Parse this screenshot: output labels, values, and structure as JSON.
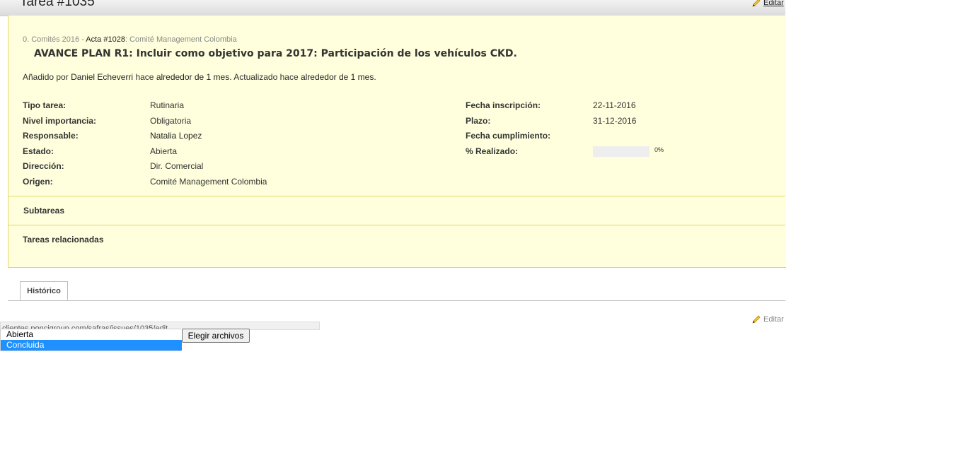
{
  "header": {
    "title": "Tarea #1035",
    "edit_label": "Editar"
  },
  "breadcrumb": {
    "parent": "0. Comités 2016",
    "separator": " - ",
    "acta": "Acta #1028",
    "acta_suffix": ": Comité Management Colombia"
  },
  "issue": {
    "subject": "AVANCE PLAN R1: Incluir como objetivo para 2017: Participación de los vehículos CKD.",
    "author_prefix": "Añadido por ",
    "author": "Daniel Echeverri",
    "author_middle": " hace ",
    "created_ago": "alrededor de 1 mes",
    "updated_prefix": ". Actualizado hace ",
    "updated_ago": "alrededor de 1 mes",
    "updated_suffix": "."
  },
  "attributes_left": [
    {
      "label": "Tipo tarea:",
      "value": "Rutinaria"
    },
    {
      "label": "Nivel importancia:",
      "value": "Obligatoria"
    },
    {
      "label": "Responsable:",
      "value": "Natalia Lopez"
    },
    {
      "label": "Estado:",
      "value": "Abierta"
    },
    {
      "label": "Dirección:",
      "value": "Dir. Comercial"
    },
    {
      "label": "Origen:",
      "value": "Comité Management Colombia"
    }
  ],
  "attributes_right": [
    {
      "label": "Fecha inscripción:",
      "value": "22-11-2016"
    },
    {
      "label": "Plazo:",
      "value": "31-12-2016"
    },
    {
      "label": "Fecha cumplimiento:",
      "value": ""
    },
    {
      "label": "% Realizado:",
      "value": "0%"
    }
  ],
  "progress": {
    "done_fraction": 0,
    "label": "0%"
  },
  "sections": {
    "subtasks": "Subtareas",
    "related": "Tareas relacionadas"
  },
  "tabs": [
    {
      "label": "Histórico",
      "active": true
    }
  ],
  "status_url": "clientes.poncigroup.com/safras/issues/1035/edit",
  "status_dropdown": {
    "options": [
      "Abierta",
      "Concluida"
    ],
    "highlighted": "Concluida"
  },
  "file_button": "Elegir archivos",
  "colors": {
    "issue_bg": "#ffffdd",
    "issue_border": "#e4d66a",
    "highlight": "#1e90ff"
  }
}
